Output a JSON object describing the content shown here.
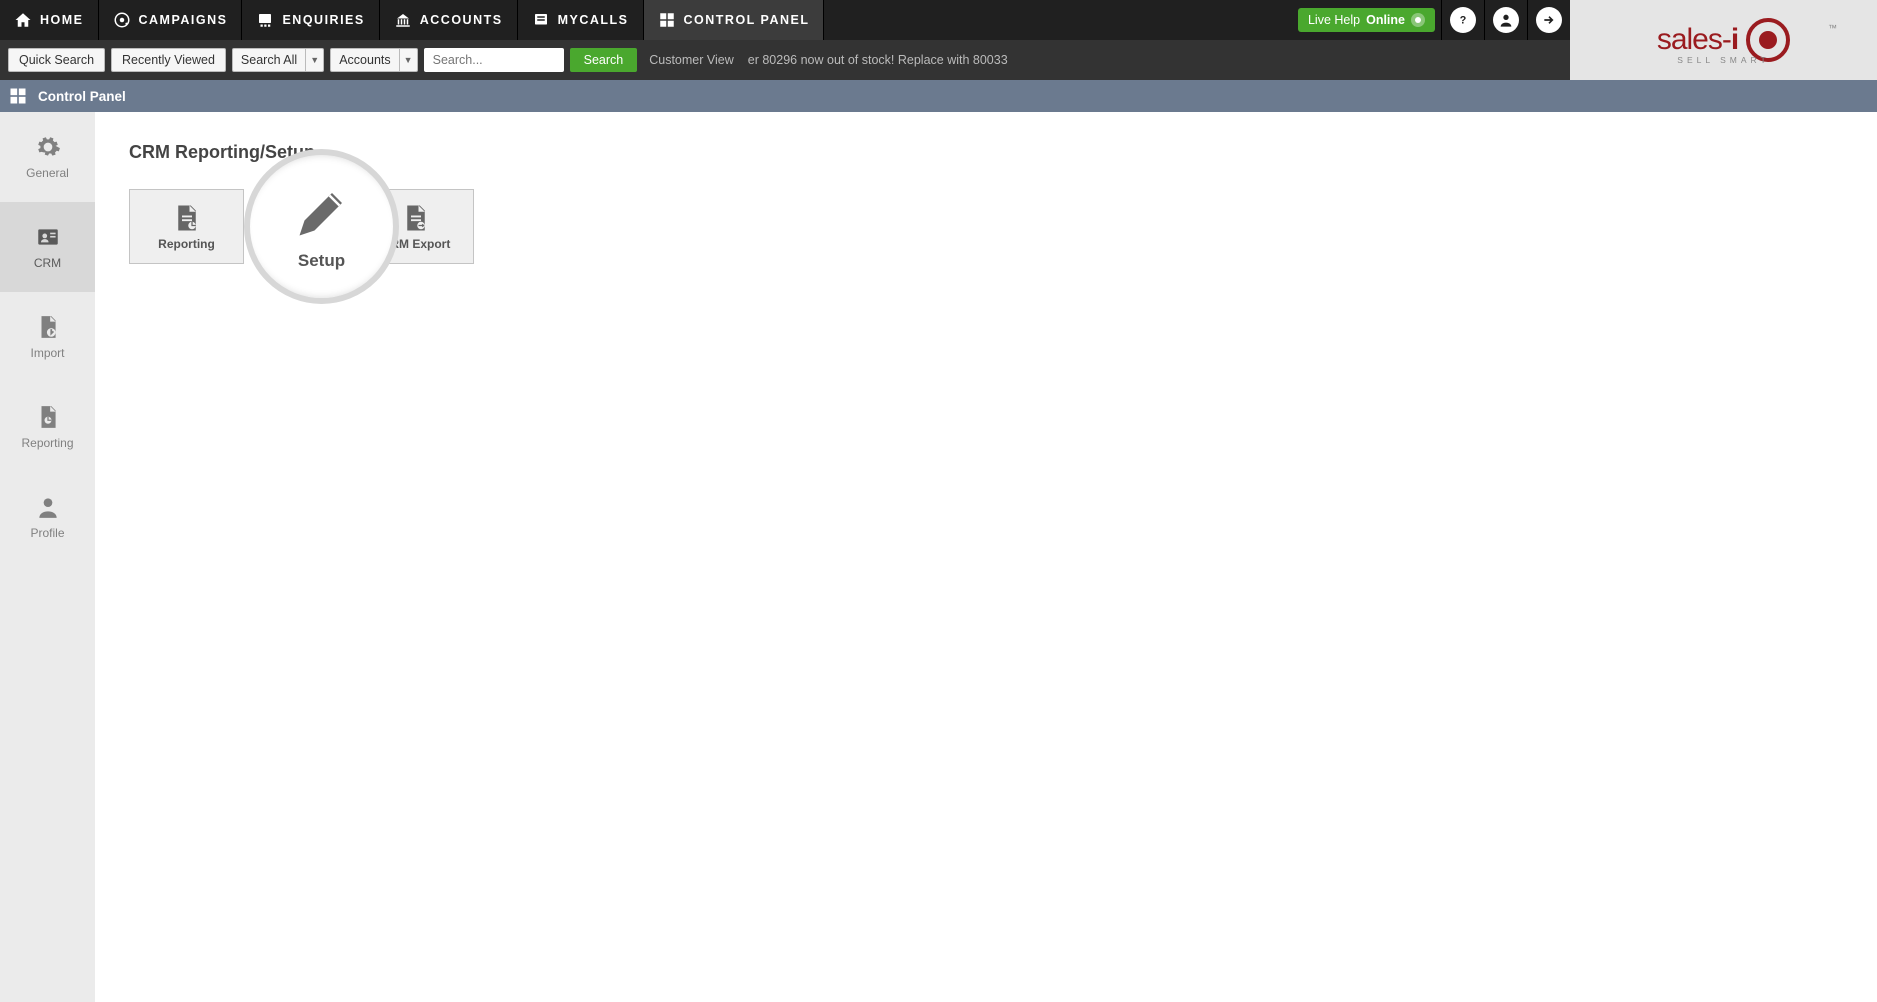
{
  "nav": {
    "items": [
      {
        "label": "HOME",
        "icon": "home"
      },
      {
        "label": "CAMPAIGNS",
        "icon": "campaign"
      },
      {
        "label": "ENQUIRIES",
        "icon": "enquiry"
      },
      {
        "label": "ACCOUNTS",
        "icon": "accounts"
      },
      {
        "label": "MYCALLS",
        "icon": "mycalls"
      },
      {
        "label": "CONTROL PANEL",
        "icon": "control",
        "active": true
      }
    ],
    "live_help_pre": "Live Help ",
    "live_help_state": "Online"
  },
  "logo": {
    "brand_a": "sales-",
    "brand_b": "i",
    "tagline": "SELL SMART",
    "tm": "™"
  },
  "toolbar": {
    "quick_search": "Quick Search",
    "recently_viewed": "Recently Viewed",
    "select1": "Search All",
    "select2": "Accounts",
    "search_placeholder": "Search...",
    "search_btn": "Search",
    "customer_view": "Customer View",
    "ticker": "er 80296 now out of stock! Replace with 80033"
  },
  "titlebar": {
    "label": "Control Panel"
  },
  "sidebar": {
    "items": [
      {
        "label": "General",
        "icon": "gear"
      },
      {
        "label": "CRM",
        "icon": "crm",
        "active": true
      },
      {
        "label": "Import",
        "icon": "import"
      },
      {
        "label": "Reporting",
        "icon": "report"
      },
      {
        "label": "Profile",
        "icon": "profile"
      }
    ]
  },
  "content": {
    "heading": "CRM Reporting/Setup",
    "tiles": [
      {
        "label": "Reporting",
        "icon": "report-doc"
      },
      {
        "label": "Setup",
        "icon": "pencil",
        "highlight": true
      },
      {
        "label": "CRM Export",
        "icon": "export-doc"
      }
    ]
  }
}
